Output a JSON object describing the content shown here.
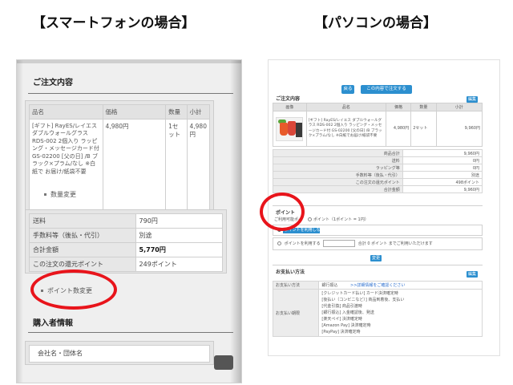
{
  "headings": {
    "smartphone": "【スマートフォンの場合】",
    "pc": "【パソコンの場合】"
  },
  "smartphone": {
    "order_section_title": "ご注文内容",
    "cart_headers": [
      "品名",
      "価格",
      "数量",
      "小計"
    ],
    "cart_row": {
      "name": "[ギフト] RayES/レイエス ダブルウォールグラス RDS-002 2個入り ラッピング・メッセージカード付 GS-02200 [父の日] /B ブラック×プラム/なし ※白紙で お届け/紙袋不要",
      "price": "4,980円",
      "qty": "1セット",
      "subtotal": "4,980円"
    },
    "qty_change_link": "数量変更",
    "summary": [
      {
        "label": "送料",
        "value": "790円"
      },
      {
        "label": "手数料等（後払・代引）",
        "value": "別途"
      },
      {
        "label": "合計金額",
        "value": "5,770円"
      },
      {
        "label": "この注文の還元ポイント",
        "value": "249ポイント"
      }
    ],
    "point_change_link": "ポイント数変更",
    "buyer_section_title": "購入者情報",
    "buyer_field_label": "会社名・団体名"
  },
  "pc": {
    "back_button": "戻る",
    "apply_button": "この内容で注文する",
    "order_section_title": "ご注文内容",
    "edit_button": "編集",
    "cart_headers": [
      "画像",
      "品名",
      "価格",
      "数量",
      "小計"
    ],
    "cart_row": {
      "name": "[ギフト] RayES/レイエス ダブルウォールグラス RDS-002 2個入り ラッピング・メッセージカード付 GS-02200 [父の日] /B ブラック×プラム/なし ※白紙でお届け/紙袋不要",
      "price": "4,980円",
      "qty": "2セット",
      "subtotal": "9,960円"
    },
    "summary": [
      {
        "label": "商品合計",
        "value": "9,960円"
      },
      {
        "label": "送料",
        "value": "0円"
      },
      {
        "label": "ラッピング等",
        "value": "0円"
      },
      {
        "label": "手数料等（後払・代引）",
        "value": "別途"
      },
      {
        "label": "この注文の還元ポイント",
        "value": "498ポイント"
      },
      {
        "label": "合計金額",
        "value": "9,960円"
      }
    ],
    "point_section_title": "ポイント",
    "point_available_label": "ご利用可能ポイ",
    "point_available_value": "ポイント（1ポイント = 1円）",
    "point_option_none": "ポイントを利用しない",
    "point_option_use": "ポイントを利用する",
    "point_option_note": "合計 0 ポイント までご利用いただけます",
    "change_button": "変更",
    "payment_section_title": "お支払い方法",
    "payment_edit_button": "編集",
    "payment_rows": [
      {
        "label": "お支払い方法",
        "value": "銀行振込",
        "link": ">>詳細情報をご確認ください"
      },
      {
        "label": "お支払い期限",
        "lines": [
          "[クレジットカード払い] カード決済確定時",
          "[後払い（コンビニなど）] 商品到着後、支払い",
          "[代金引換] 商品引渡時",
          "[銀行振込] 入金確認後、発送",
          "[楽天ペイ] 決済確定時",
          "[Amazon Pay] 決済確定時",
          "[PayPay] 決済確定時"
        ]
      }
    ]
  },
  "colors": {
    "highlight": "#e8141b",
    "button_blue": "#2c8fcf"
  }
}
